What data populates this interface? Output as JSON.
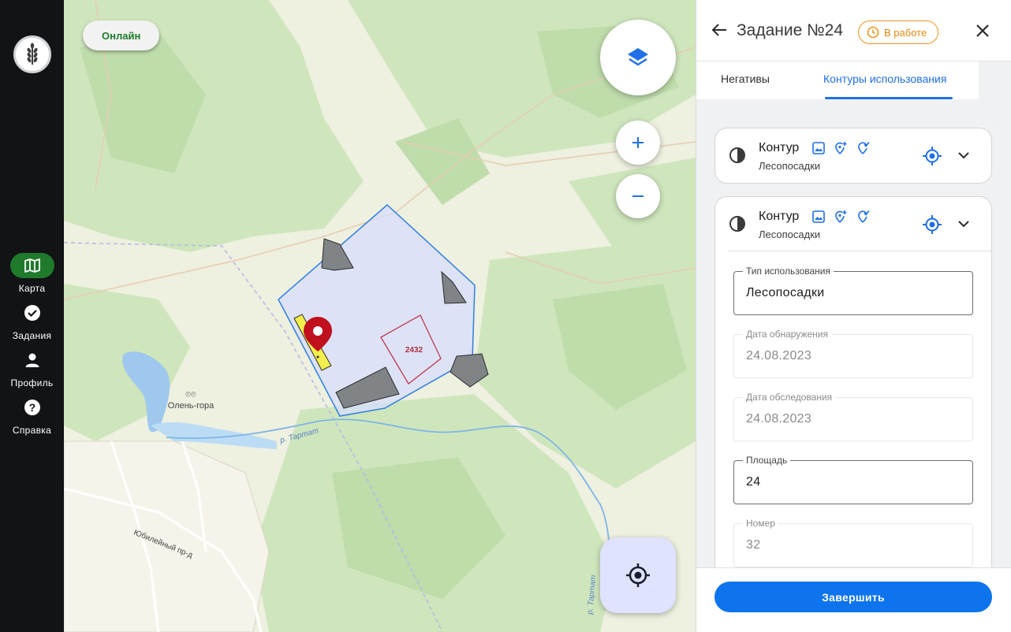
{
  "nav": {
    "items": [
      {
        "label": "Карта",
        "icon": "map-icon",
        "active": true
      },
      {
        "label": "Задания",
        "icon": "check-circle-icon",
        "active": false
      },
      {
        "label": "Профиль",
        "icon": "person-icon",
        "active": false
      },
      {
        "label": "Справка",
        "icon": "help-icon",
        "active": false
      }
    ]
  },
  "map": {
    "online_label": "Онлайн",
    "place_label": "Олень-гора",
    "river_label_1": "р. Тартат",
    "river_label_2": "р. Тартат",
    "street_label": "Юбилейный пр-д",
    "parcel_label": "2432",
    "layers_icon": "layers-icon",
    "zoom_in_icon": "plus-icon",
    "zoom_out_icon": "minus-icon",
    "locate_icon": "crosshair-icon"
  },
  "panel": {
    "title": "Задание №24",
    "status": "В работе",
    "status_color": "#f0931e",
    "tabs": [
      {
        "label": "Негативы",
        "active": false
      },
      {
        "label": "Контуры использования",
        "active": true
      }
    ],
    "accent": "#1f6fe8",
    "cards": [
      {
        "title": "Контур",
        "subtitle": "Лесопосадки",
        "expanded": false
      },
      {
        "title": "Контур",
        "subtitle": "Лесопосадки",
        "expanded": true
      }
    ],
    "fields": {
      "usage_type": {
        "label": "Тип использования",
        "value": "Лесопосадки"
      },
      "detect_date": {
        "label": "Дата обнаружения",
        "value": "24.08.2023"
      },
      "survey_date": {
        "label": "Дата обследования",
        "value": "24.08.2023"
      },
      "area": {
        "label": "Площадь",
        "value": "24"
      },
      "number": {
        "label": "Номер",
        "value": "32"
      }
    },
    "finish_label": "Завершить"
  }
}
